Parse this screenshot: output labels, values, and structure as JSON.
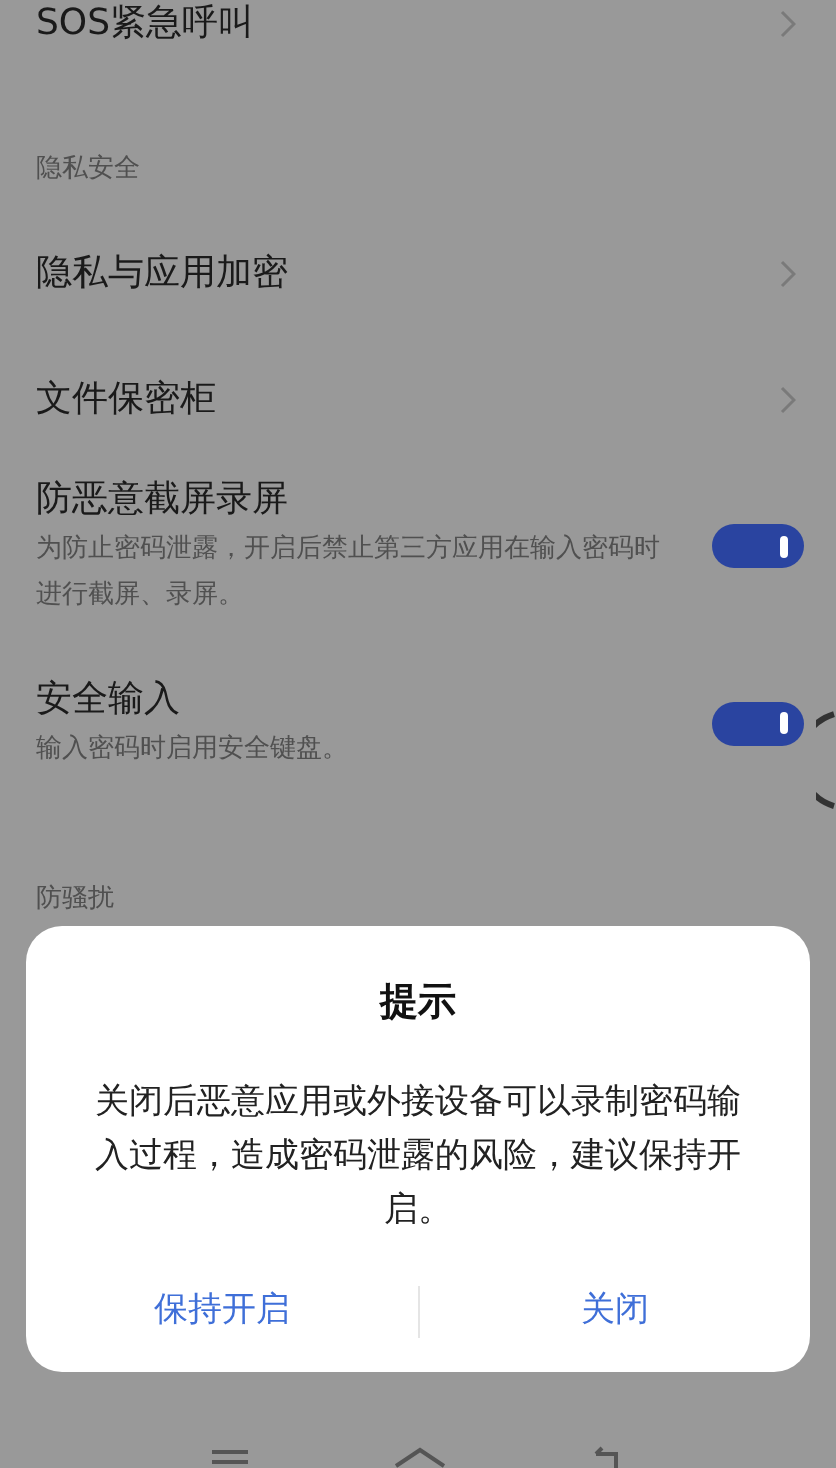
{
  "settings": {
    "items": [
      {
        "kind": "link",
        "title": "SOS紧急呼叫"
      },
      {
        "kind": "header",
        "title": "隐私安全"
      },
      {
        "kind": "link",
        "title": "隐私与应用加密"
      },
      {
        "kind": "link",
        "title": "文件保密柜"
      },
      {
        "kind": "toggle",
        "title": "防恶意截屏录屏",
        "description": "为防止密码泄露，开启后禁止第三方应用在输入密码时进行截屏、录屏。",
        "on": true
      },
      {
        "kind": "toggle",
        "title": "安全输入",
        "description": "输入密码时启用安全键盘。",
        "on": true
      },
      {
        "kind": "header",
        "title": "防骚扰"
      }
    ]
  },
  "dialog": {
    "title": "提示",
    "message": "关闭后恶意应用或外接设备可以录制密码输入过程，造成密码泄露的风险，建议保持开启。",
    "buttons": [
      {
        "label": "保持开启"
      },
      {
        "label": "关闭"
      }
    ]
  }
}
